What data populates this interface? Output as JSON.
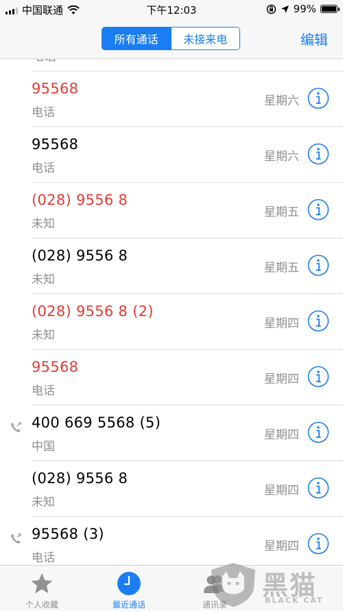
{
  "status_bar": {
    "carrier": "中国联通",
    "time": "下午12:03",
    "battery_percent": "99%",
    "battery_level": 0.99
  },
  "nav": {
    "segments": [
      "所有通话",
      "未接来电"
    ],
    "active_segment": 0,
    "edit_label": "编辑"
  },
  "calls": [
    {
      "name": "95568",
      "label": "电话",
      "day": "星期六",
      "missed": true,
      "outgoing": false
    },
    {
      "name": "95568",
      "label": "电话",
      "day": "星期六",
      "missed": false,
      "outgoing": false
    },
    {
      "name": "(028) 9556 8",
      "label": "未知",
      "day": "星期五",
      "missed": true,
      "outgoing": false
    },
    {
      "name": "(028) 9556 8",
      "label": "未知",
      "day": "星期五",
      "missed": false,
      "outgoing": false
    },
    {
      "name": "(028) 9556 8 (2)",
      "label": "未知",
      "day": "星期四",
      "missed": true,
      "outgoing": false
    },
    {
      "name": "95568",
      "label": "电话",
      "day": "星期四",
      "missed": true,
      "outgoing": false
    },
    {
      "name": "400 669 5568 (5)",
      "label": "中国",
      "day": "星期四",
      "missed": false,
      "outgoing": true
    },
    {
      "name": "(028) 9556 8",
      "label": "未知",
      "day": "星期四",
      "missed": false,
      "outgoing": false
    },
    {
      "name": "95568 (3)",
      "label": "电话",
      "day": "星期四",
      "missed": false,
      "outgoing": true
    }
  ],
  "partial_top_label": "电话",
  "tabs": [
    {
      "label": "个人收藏",
      "icon": "star-icon",
      "active": false
    },
    {
      "label": "最近通话",
      "icon": "clock-icon",
      "active": true
    },
    {
      "label": "通讯录",
      "icon": "contacts-icon",
      "active": false
    }
  ],
  "watermark": {
    "text": "黑猫",
    "sub": "BLACK CAT"
  },
  "colors": {
    "accent": "#1a7ef2",
    "missed": "#e63a32",
    "secondary": "#8e8e93"
  }
}
